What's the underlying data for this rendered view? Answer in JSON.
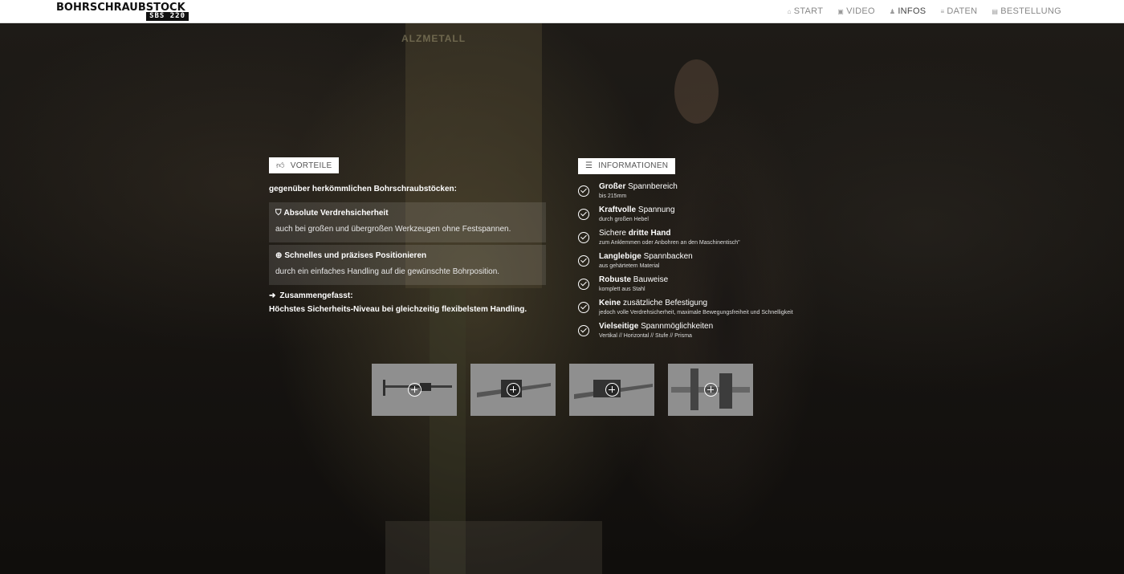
{
  "header": {
    "logo_main": "BOHRSCHRAUBSTOCK",
    "logo_sub": "SBS 220",
    "nav": [
      {
        "label": "START",
        "icon": "home-icon",
        "glyph": "⌂"
      },
      {
        "label": "VIDEO",
        "icon": "video-icon",
        "glyph": "▣"
      },
      {
        "label": "INFOS",
        "icon": "person-icon",
        "glyph": "♟"
      },
      {
        "label": "DATEN",
        "icon": "list-icon",
        "glyph": "≡"
      },
      {
        "label": "BESTELLUNG",
        "icon": "document-icon",
        "glyph": "▤"
      }
    ],
    "active_nav": "INFOS"
  },
  "vorteile": {
    "label": "VORTEILE",
    "intro": "gegenüber herkömmlichen Bohrschraubstöcken:",
    "features": [
      {
        "title": "Absolute Verdrehsicherheit",
        "text": "auch bei großen und übergroßen Werkzeugen ohne Festspannen.",
        "icon": "shield-icon",
        "glyph": "⛉"
      },
      {
        "title": "Schnelles und präzises Positionieren",
        "text": "durch ein einfaches Handling auf die gewünschte Bohrposition.",
        "icon": "crosshair-icon",
        "glyph": "⊕"
      }
    ],
    "summary_title": "Zusammengefasst:",
    "summary_text": "Höchstes Sicherheits-Niveau bei gleichzeitig flexibelstem Handling."
  },
  "informationen": {
    "label": "INFORMATIONEN",
    "items": [
      {
        "bold": "Großer",
        "rest": " Spannbereich",
        "sub": "bis 215mm"
      },
      {
        "bold": "Kraftvolle",
        "rest": " Spannung",
        "sub": "durch großen Hebel"
      },
      {
        "pre": "Sichere ",
        "bold": "dritte Hand",
        "rest": "",
        "sub": "zum Anklemmen oder Anbohren an den Maschinentisch\""
      },
      {
        "bold": "Langlebige",
        "rest": " Spannbacken",
        "sub": "aus gehärtetem Material"
      },
      {
        "bold": "Robuste",
        "rest": " Bauweise",
        "sub": "komplett aus Stahl"
      },
      {
        "bold": "Keine",
        "rest": " zusätzliche Befestigung",
        "sub": "jedoch volle Verdrehsicherheit, maximale Bewegungsfreiheit und Schnelligkeit"
      },
      {
        "bold": "Vielseitige",
        "rest": " Spannmöglichkeiten",
        "sub": "Vertikal // Horizontal // Stufe // Prisma"
      }
    ]
  },
  "background_sign": "ALZMETALL",
  "gallery": [
    {
      "name": "gallery-thumb-1",
      "icon": "zoom-plus-icon"
    },
    {
      "name": "gallery-thumb-2",
      "icon": "zoom-plus-icon"
    },
    {
      "name": "gallery-thumb-3",
      "icon": "zoom-plus-icon"
    },
    {
      "name": "gallery-thumb-4",
      "icon": "zoom-plus-icon"
    }
  ],
  "colors": {
    "header_bg": "#ffffff",
    "page_bg": "#141210",
    "label_bg": "#ffffff",
    "thumb_bg": "#8f8f8f"
  }
}
